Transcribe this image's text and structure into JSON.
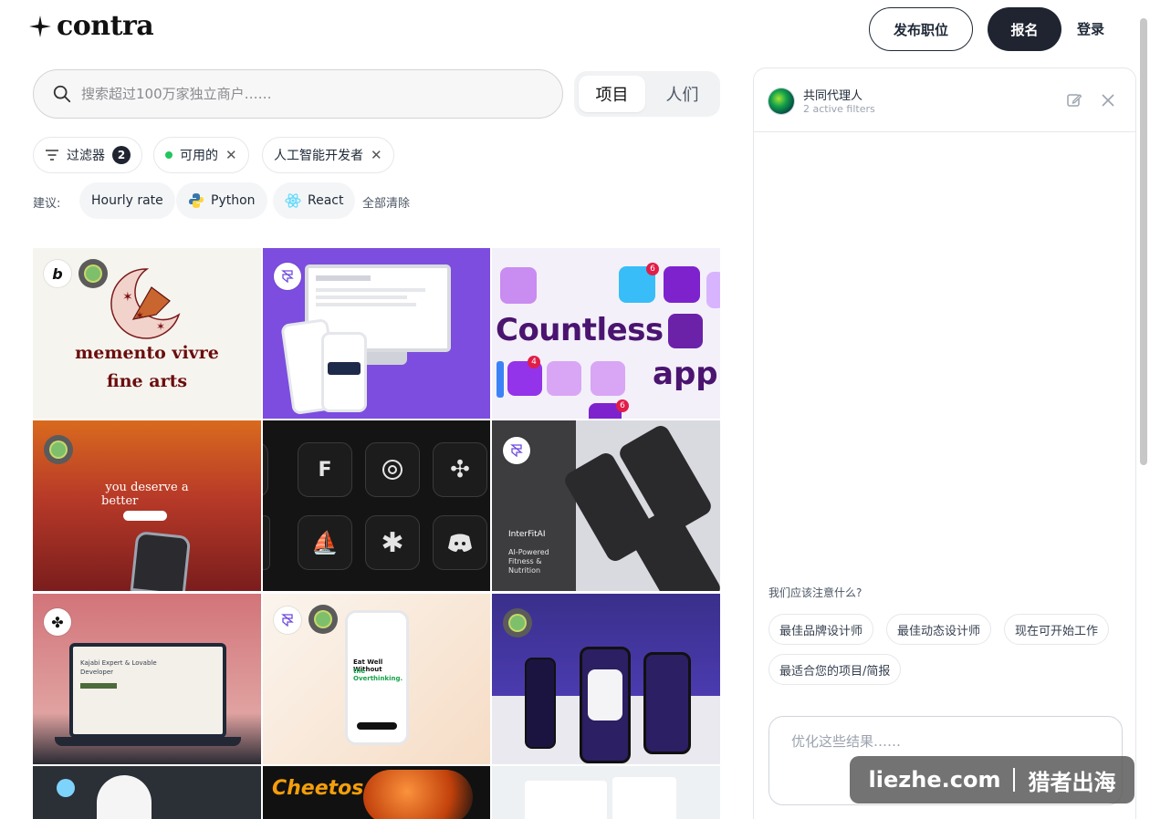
{
  "header": {
    "logo_text": "contra",
    "post_job": "发布职位",
    "sign_up": "报名",
    "login": "登录"
  },
  "search": {
    "placeholder": "搜索超过100万家独立商户……",
    "tabs": [
      {
        "label": "项目",
        "active": true
      },
      {
        "label": "人们",
        "active": false
      }
    ]
  },
  "filters": {
    "filter_label": "过滤器",
    "filter_count": "2",
    "active": [
      "可用的",
      "人工智能开发者"
    ]
  },
  "suggestions": {
    "label": "建议:",
    "items": [
      "Hourly rate",
      "Python",
      "React"
    ],
    "clear_all": "全部清除"
  },
  "grid": {
    "tile_texts": {
      "memento_line1": "memento vivre",
      "memento_line2": "fine arts",
      "countless": "Countless",
      "app": "app",
      "deserve_line1": "you deserve a",
      "deserve_line2": "better",
      "interfit_brand": "InterFitAI",
      "interfit_tag": "AI-Powered Fitness & Nutrition",
      "eat_well_line1": "Eat Well Without",
      "eat_well_line2": "the Overthinking.",
      "kajabi_line1": "Kajabi Expert & Lovable",
      "kajabi_line2": "Developer",
      "cheetos": "Cheetos",
      "icon_badge_1": "6",
      "icon_badge_2": "4",
      "icon_badge_3": "6"
    }
  },
  "agent_panel": {
    "title": "共同代理人",
    "subtitle": "2 active filters",
    "question": "我们应该注意什么?",
    "quick_prompts": [
      "最佳品牌设计师",
      "最佳动态设计师",
      "现在可开始工作",
      "最适合您的项目/简报"
    ],
    "refine_placeholder": "优化这些结果……"
  },
  "watermark": {
    "left": "liezhe.com",
    "right": "猎者出海"
  },
  "colors": {
    "primary_dark": "#1f2430",
    "available_green": "#22c55e",
    "accent_purple": "#7c4dff"
  }
}
